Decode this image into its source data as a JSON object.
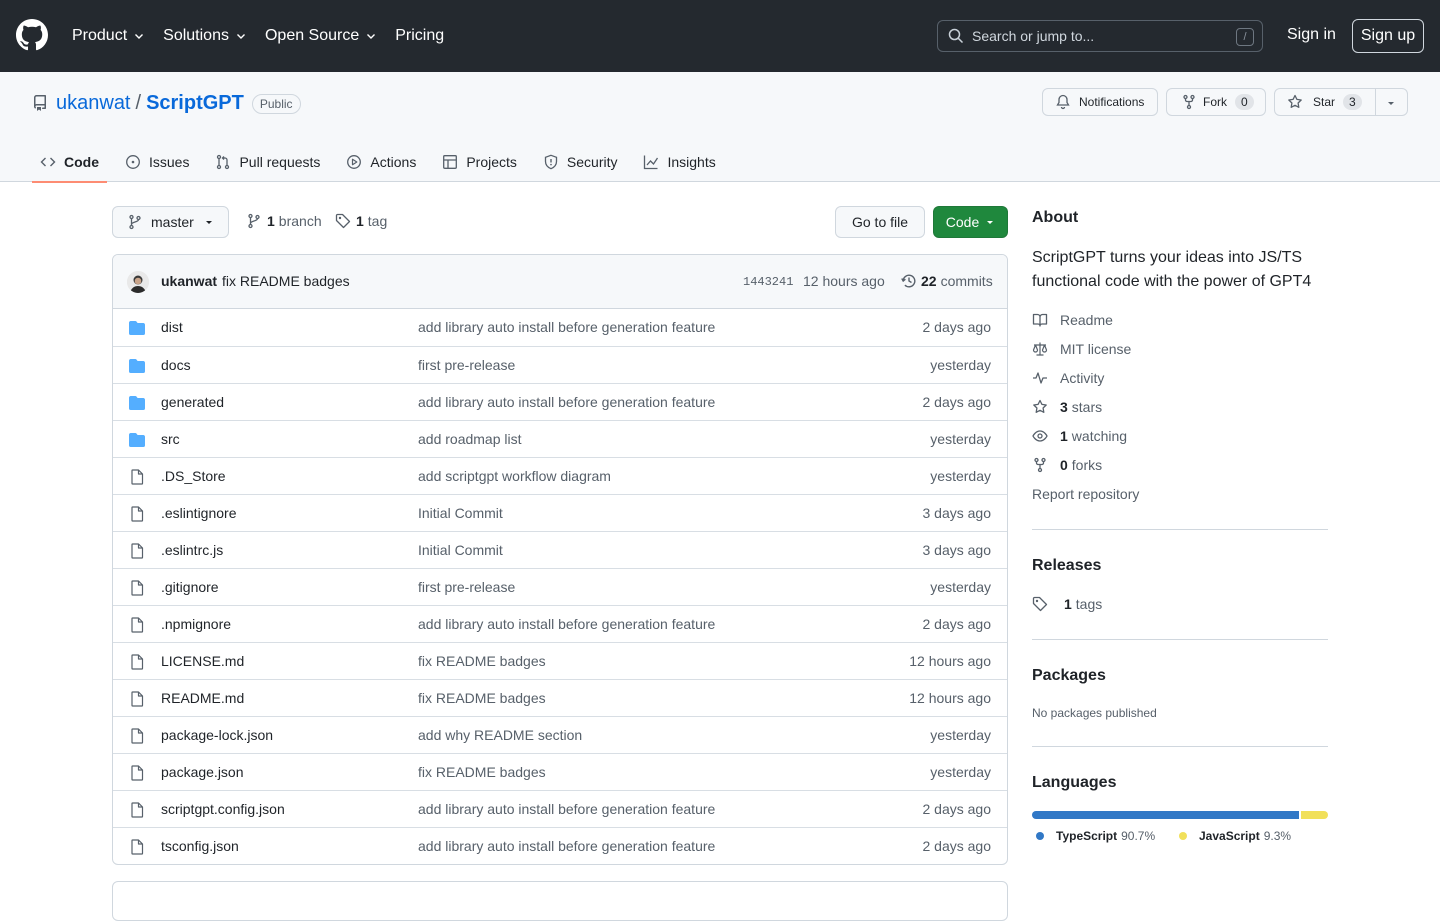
{
  "header": {
    "nav": [
      "Product",
      "Solutions",
      "Open Source",
      "Pricing"
    ],
    "search_placeholder": "Search or jump to...",
    "search_shortcut": "/",
    "signin": "Sign in",
    "signup": "Sign up"
  },
  "repo": {
    "owner": "ukanwat",
    "separator": "/",
    "name": "ScriptGPT",
    "visibility": "Public",
    "notifications_label": "Notifications",
    "fork_label": "Fork",
    "fork_count": "0",
    "star_label": "Star",
    "star_count": "3"
  },
  "repo_nav": [
    {
      "label": "Code",
      "icon": "code-icon",
      "active": true
    },
    {
      "label": "Issues",
      "icon": "issue-icon"
    },
    {
      "label": "Pull requests",
      "icon": "pull-request-icon"
    },
    {
      "label": "Actions",
      "icon": "play-icon"
    },
    {
      "label": "Projects",
      "icon": "table-icon"
    },
    {
      "label": "Security",
      "icon": "shield-icon"
    },
    {
      "label": "Insights",
      "icon": "graph-icon"
    }
  ],
  "branch_bar": {
    "branch": "master",
    "branch_count": "1",
    "branch_label": "branch",
    "tag_count": "1",
    "tag_label": "tag",
    "goto_file": "Go to file",
    "code_button": "Code"
  },
  "latest_commit": {
    "author": "ukanwat",
    "message": "fix README badges",
    "sha": "1443241",
    "time": "12 hours ago",
    "commit_count": "22",
    "commit_label": "commits"
  },
  "files": [
    {
      "name": "dist",
      "type": "dir",
      "message": "add library auto install before generation feature",
      "age": "2 days ago"
    },
    {
      "name": "docs",
      "type": "dir",
      "message": "first pre-release",
      "age": "yesterday"
    },
    {
      "name": "generated",
      "type": "dir",
      "message": "add library auto install before generation feature",
      "age": "2 days ago"
    },
    {
      "name": "src",
      "type": "dir",
      "message": "add roadmap list",
      "age": "yesterday"
    },
    {
      "name": ".DS_Store",
      "type": "file",
      "message": "add scriptgpt workflow diagram",
      "age": "yesterday"
    },
    {
      "name": ".eslintignore",
      "type": "file",
      "message": "Initial Commit",
      "age": "3 days ago"
    },
    {
      "name": ".eslintrc.js",
      "type": "file",
      "message": "Initial Commit",
      "age": "3 days ago"
    },
    {
      "name": ".gitignore",
      "type": "file",
      "message": "first pre-release",
      "age": "yesterday"
    },
    {
      "name": ".npmignore",
      "type": "file",
      "message": "add library auto install before generation feature",
      "age": "2 days ago"
    },
    {
      "name": "LICENSE.md",
      "type": "file",
      "message": "fix README badges",
      "age": "12 hours ago"
    },
    {
      "name": "README.md",
      "type": "file",
      "message": "fix README badges",
      "age": "12 hours ago"
    },
    {
      "name": "package-lock.json",
      "type": "file",
      "message": "add why README section",
      "age": "yesterday"
    },
    {
      "name": "package.json",
      "type": "file",
      "message": "fix README badges",
      "age": "yesterday"
    },
    {
      "name": "scriptgpt.config.json",
      "type": "file",
      "message": "add library auto install before generation feature",
      "age": "2 days ago"
    },
    {
      "name": "tsconfig.json",
      "type": "file",
      "message": "add library auto install before generation feature",
      "age": "2 days ago"
    }
  ],
  "about": {
    "title": "About",
    "description": "ScriptGPT turns your ideas into JS/TS functional code with the power of GPT4",
    "readme": "Readme",
    "license": "MIT license",
    "activity": "Activity",
    "stars_count": "3",
    "stars_label": "stars",
    "watching_count": "1",
    "watching_label": "watching",
    "forks_count": "0",
    "forks_label": "forks",
    "report": "Report repository"
  },
  "releases": {
    "title": "Releases",
    "count": "1",
    "label": "tags"
  },
  "packages": {
    "title": "Packages",
    "empty": "No packages published"
  },
  "languages": {
    "title": "Languages",
    "items": [
      {
        "name": "TypeScript",
        "percent": 90.7,
        "percent_label": "90.7%",
        "color": "#3178c6"
      },
      {
        "name": "JavaScript",
        "percent": 9.3,
        "percent_label": "9.3%",
        "color": "#f1e05a"
      }
    ]
  }
}
